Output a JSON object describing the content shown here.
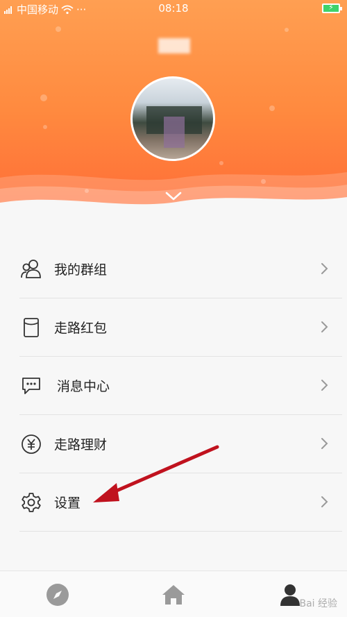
{
  "status_bar": {
    "carrier": "中国移动",
    "time": "08:18"
  },
  "menu": {
    "items": [
      {
        "icon": "group-icon",
        "label": "我的群组"
      },
      {
        "icon": "red-packet-icon",
        "label": "走路红包"
      },
      {
        "icon": "message-icon",
        "label": "消息中心"
      },
      {
        "icon": "yuan-icon",
        "label": "走路理财"
      },
      {
        "icon": "gear-icon",
        "label": "设置"
      }
    ]
  },
  "tabs": [
    {
      "icon": "compass-icon"
    },
    {
      "icon": "home-icon"
    },
    {
      "icon": "profile-icon"
    }
  ],
  "colors": {
    "header_top": "#ff9f52",
    "header_bottom": "#ff6a36",
    "annotation_arrow": "#c0121e"
  },
  "watermark": "Bai 经验"
}
